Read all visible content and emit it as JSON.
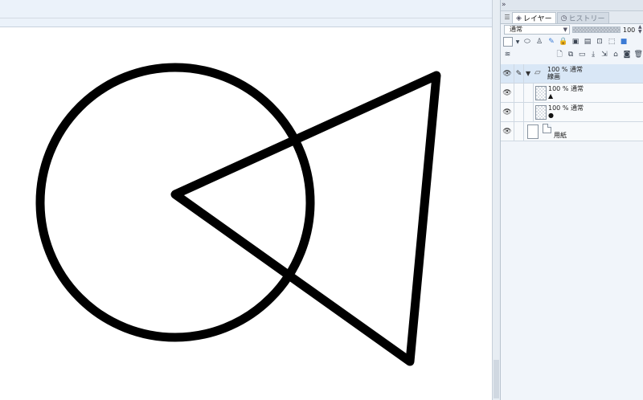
{
  "panel": {
    "collapse_icon": "»",
    "tabs": [
      {
        "label": "レイヤー",
        "icon": "layers-icon",
        "active": true
      },
      {
        "label": "ヒストリー",
        "icon": "history-icon",
        "active": false
      }
    ],
    "blend_mode": "通常",
    "opacity_value": "100",
    "opacity_percent": 100
  },
  "layers": [
    {
      "opacity_mode": "100 % 通常",
      "name": "線画",
      "type": "folder",
      "selected": true
    },
    {
      "opacity_mode": "100 % 通常",
      "name": "▲",
      "type": "raster"
    },
    {
      "opacity_mode": "100 % 通常",
      "name": "●",
      "type": "raster"
    },
    {
      "opacity_mode": "",
      "name": "用紙",
      "type": "paper"
    }
  ],
  "canvas": {
    "stroke_color": "#000000",
    "shapes": [
      "circle",
      "triangle"
    ]
  },
  "colors": {
    "accent": "#3b7bd5",
    "panel_bg": "#f1f5fa",
    "selected_layer": "#d9e7f6"
  }
}
